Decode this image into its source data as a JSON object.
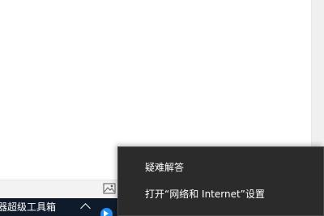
{
  "taskbar": {
    "app_label": "器超级工具箱",
    "tray_icons": [
      "chevron-up-icon",
      "blue-app-icon",
      "network-icon",
      "tray-icon"
    ]
  },
  "status_strip": {
    "icon": "image-icon"
  },
  "context_menu": {
    "items": [
      {
        "label": "疑难解答"
      },
      {
        "label": "打开“网络和 Internet”设置"
      }
    ]
  },
  "colors": {
    "menu_background": "#2b2b2b",
    "taskbar_background": "#0f1b2b",
    "accent_blue": "#1e90ff"
  }
}
